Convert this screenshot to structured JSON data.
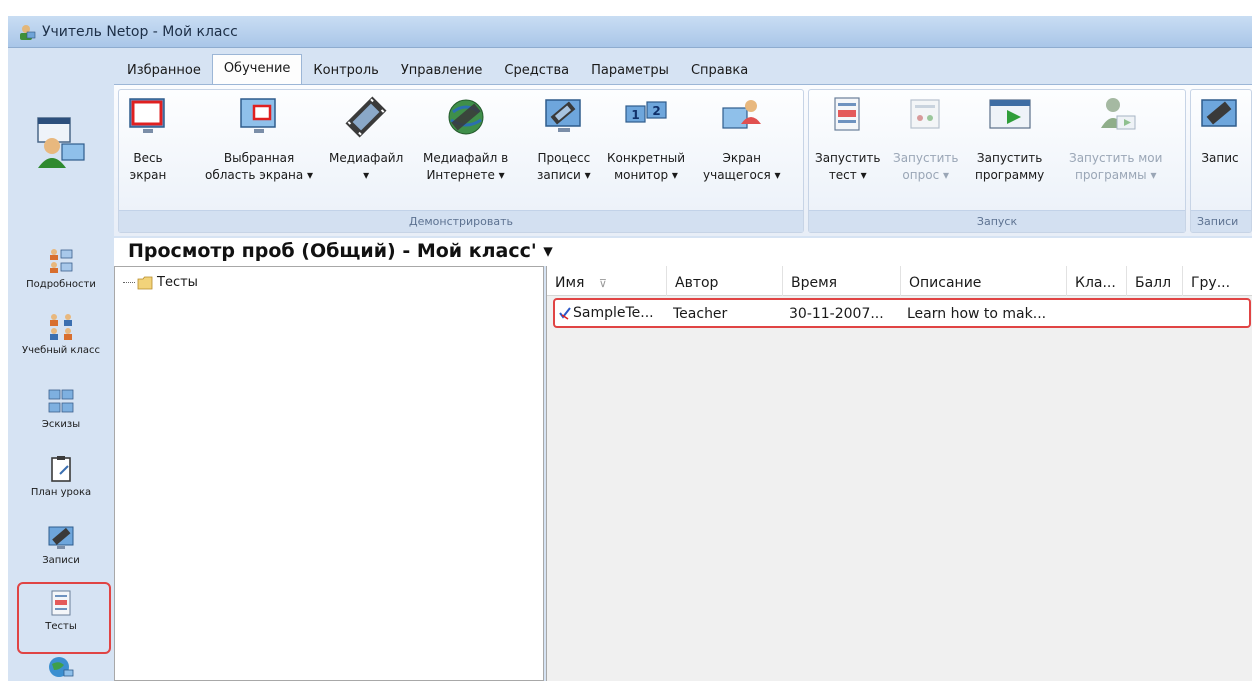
{
  "window": {
    "title": "Учитель Netop - Мой класс"
  },
  "menu": {
    "tabs": [
      "Избранное",
      "Обучение",
      "Контроль",
      "Управление",
      "Средства",
      "Параметры",
      "Справка"
    ]
  },
  "ribbon": {
    "demo": {
      "label": "Демонстрировать",
      "buttons": [
        [
          "Весь",
          "экран"
        ],
        [
          "Выбранная",
          "область экрана ▾"
        ],
        [
          "Медиафайл",
          "▾"
        ],
        [
          "Медиафайл в",
          "Интернете ▾"
        ],
        [
          "Процесс",
          "записи ▾"
        ],
        [
          "Конкретный",
          "монитор ▾"
        ],
        [
          "Экран",
          "учащегося ▾"
        ]
      ]
    },
    "launch": {
      "label": "Запуск",
      "buttons": [
        [
          "Запустить",
          "тест ▾"
        ],
        [
          "Запустить",
          "опрос ▾"
        ],
        [
          "Запустить",
          "программу"
        ],
        [
          "Запустить мои",
          "программы ▾"
        ]
      ]
    },
    "records": {
      "label": "Записи",
      "button": "Запис"
    }
  },
  "view": {
    "title": "Просмотр проб (Общий)  - Мой класс' ▾"
  },
  "tree": {
    "root": "Тесты"
  },
  "grid": {
    "columns": [
      "Имя",
      "Автор",
      "Время",
      "Описание",
      "Кла...",
      "Балл",
      "Гру..."
    ],
    "rows": [
      {
        "name": "SampleTe...",
        "author": "Teacher",
        "time": "30-11-2007...",
        "description": "Learn how to mak..."
      }
    ]
  },
  "nav": {
    "items": [
      "Подробности",
      "Учебный класс",
      "Эскизы",
      "План урока",
      "Записи",
      "Тесты"
    ]
  }
}
